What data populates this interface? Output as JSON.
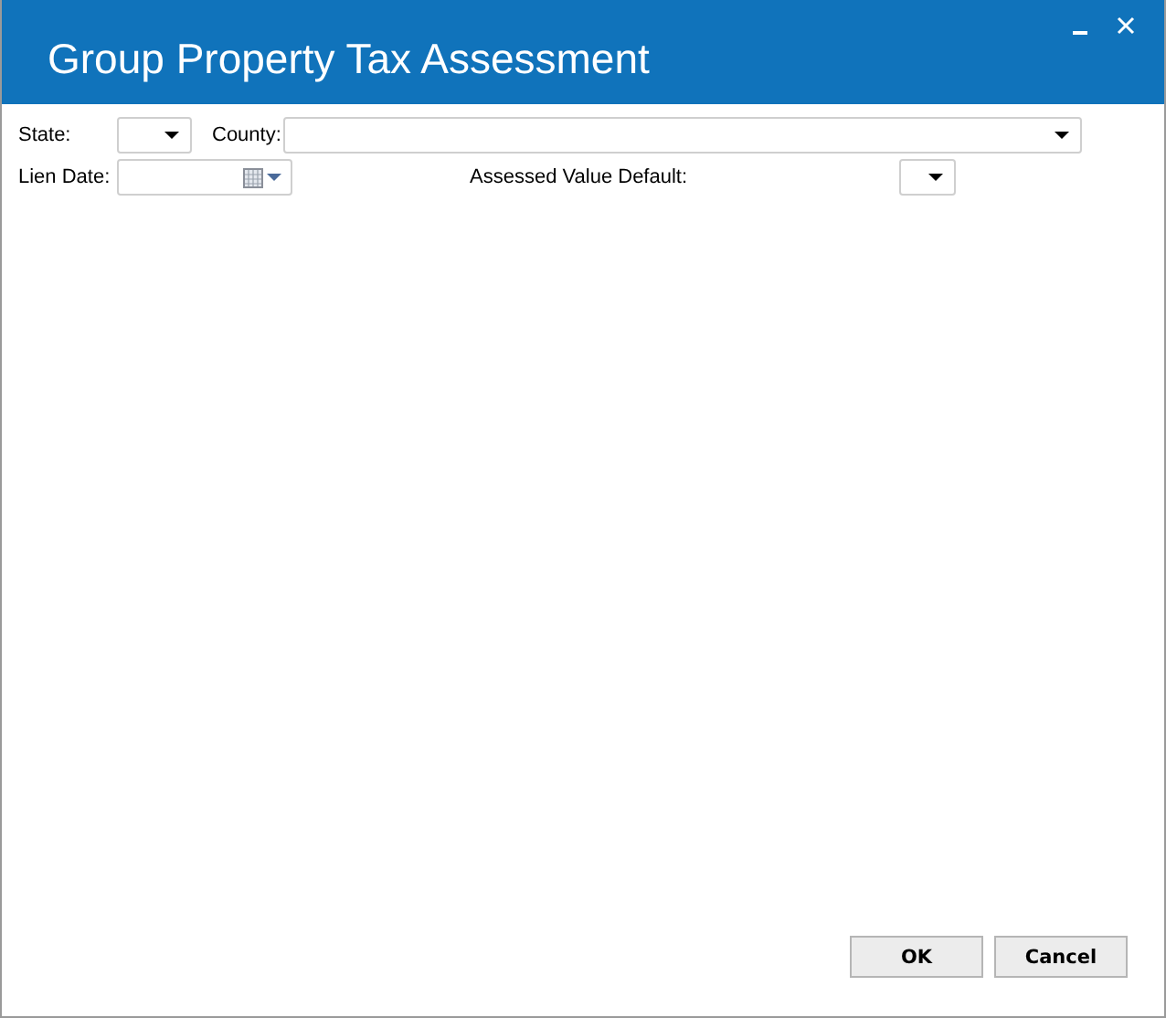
{
  "window": {
    "title": "Group Property Tax Assessment"
  },
  "fields": {
    "state_label": "State:",
    "county_label": "County:",
    "lien_date_label": "Lien Date:",
    "assessed_label": "Assessed Value Default:"
  },
  "buttons": [
    {
      "label": "OK"
    },
    {
      "label": "Cancel"
    }
  ]
}
